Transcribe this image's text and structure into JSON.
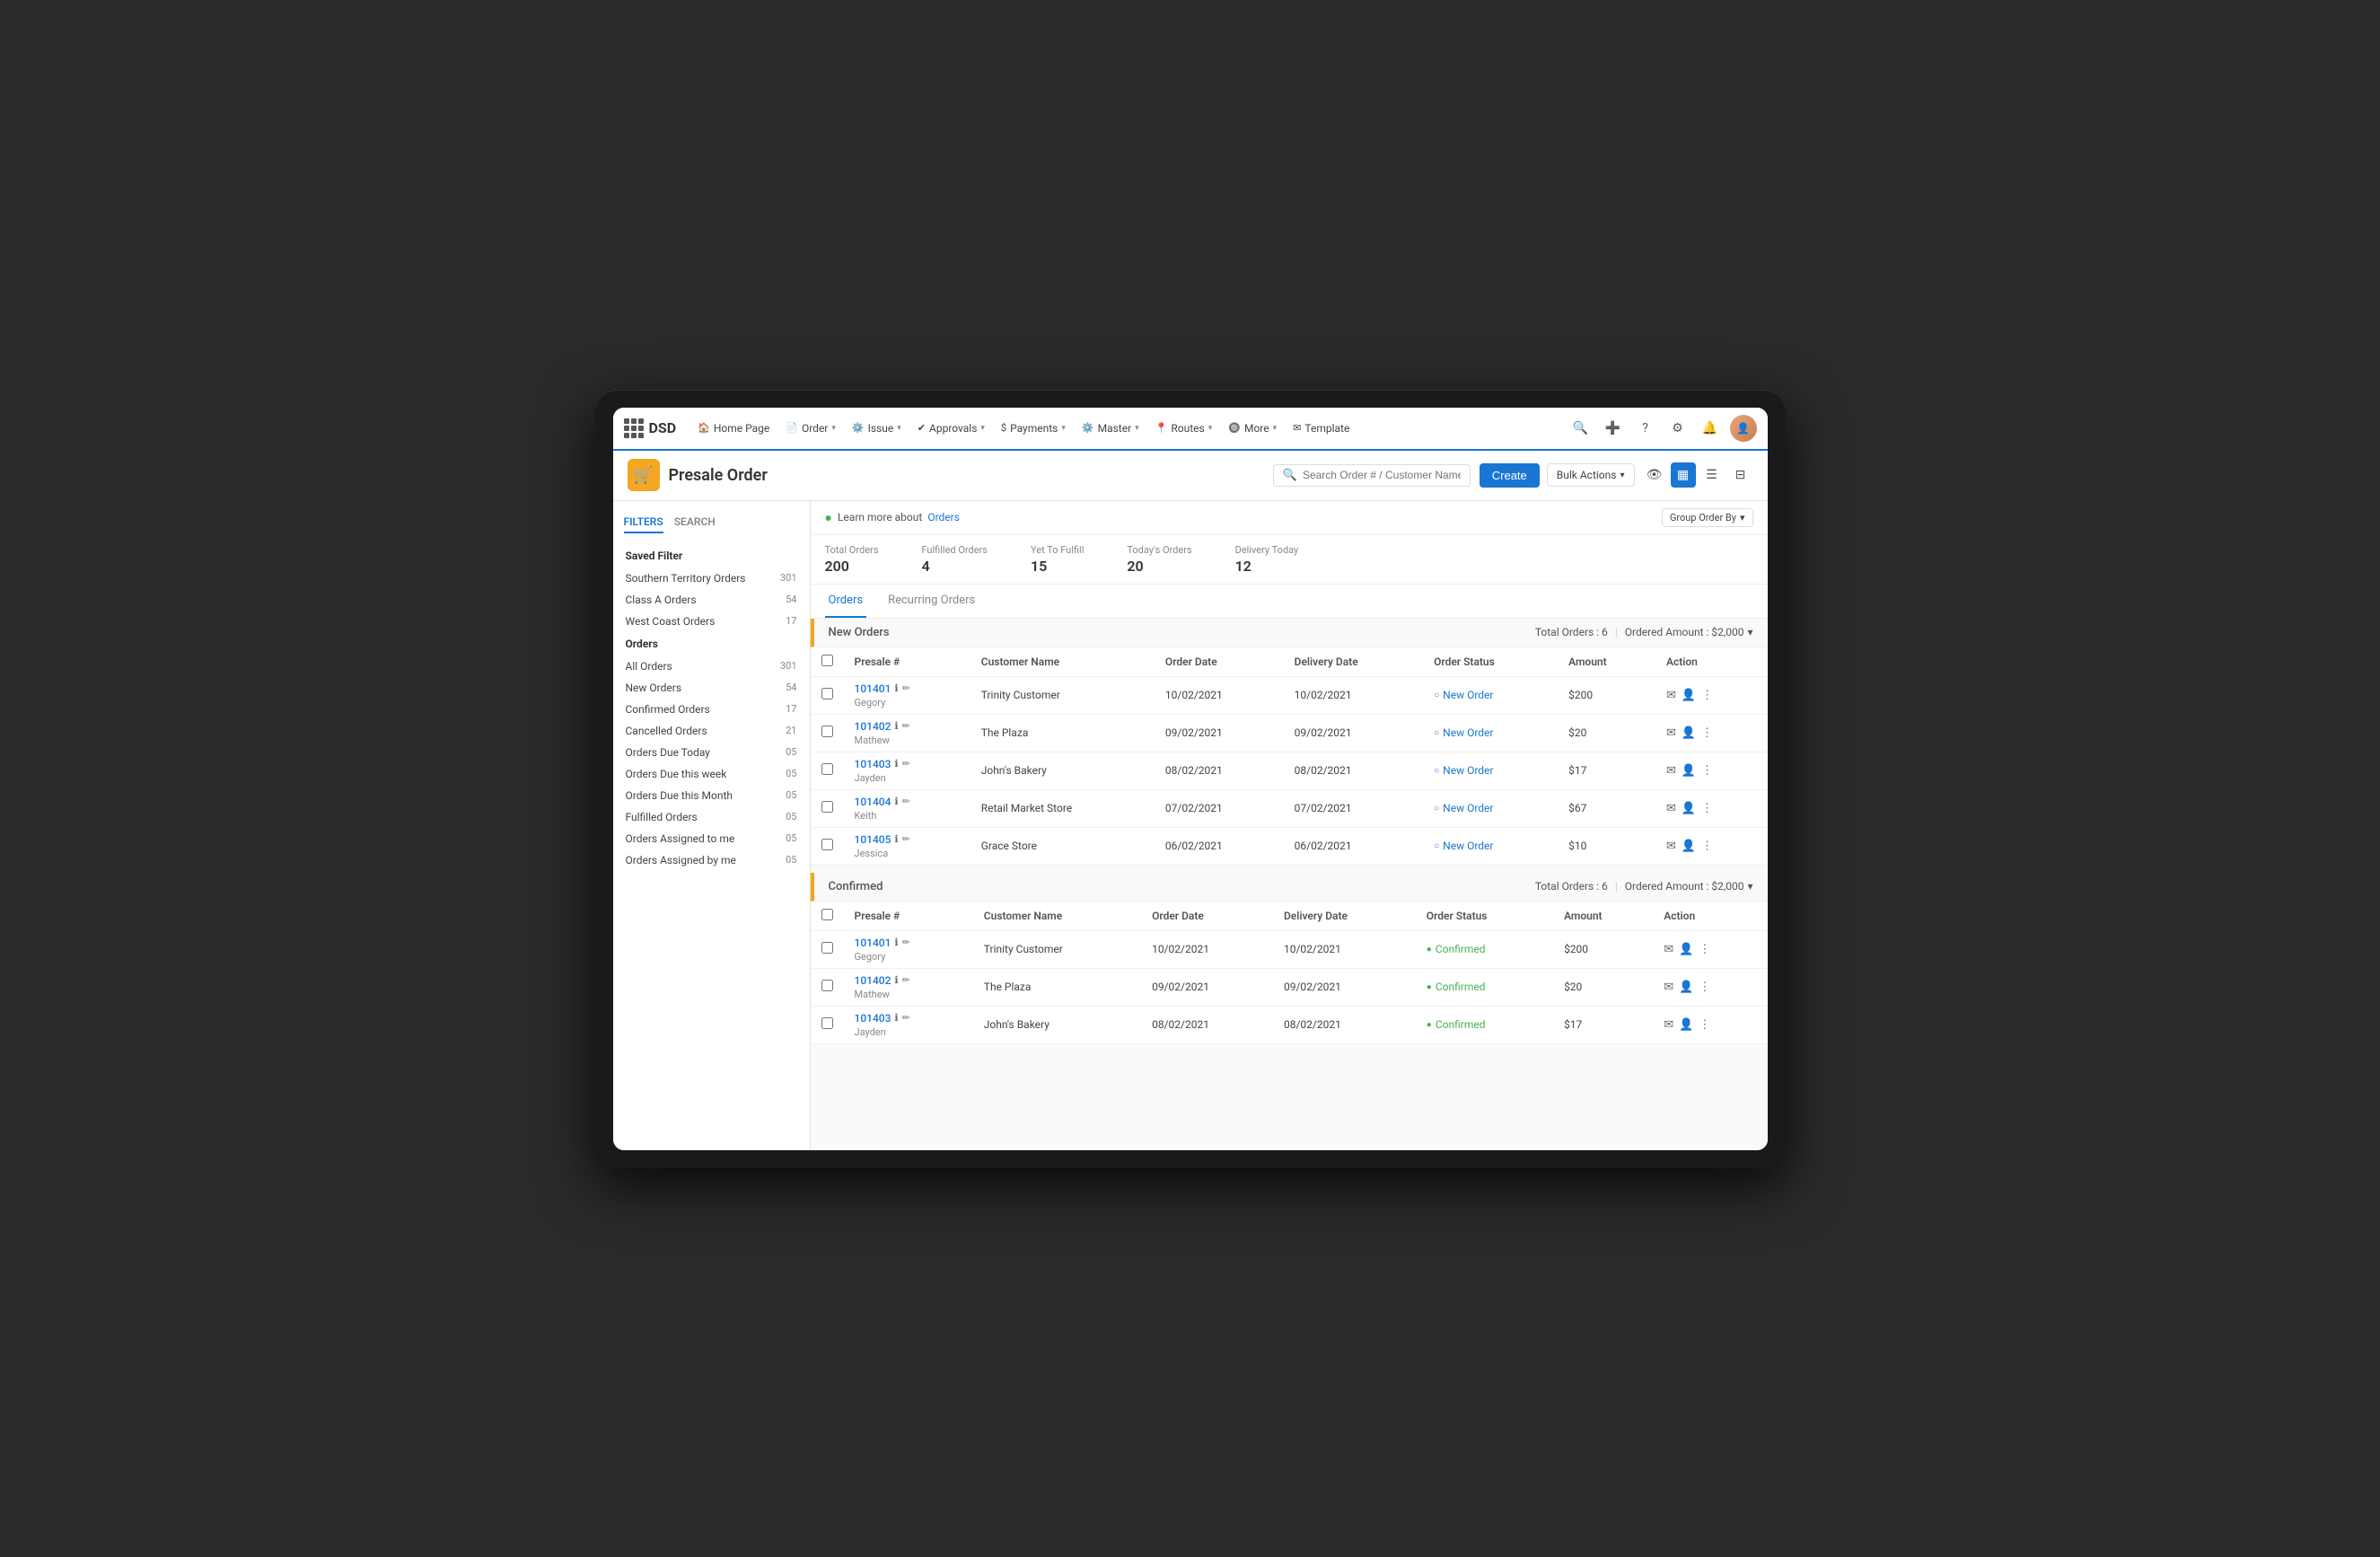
{
  "app": {
    "logo_text": "DSD",
    "nav_items": [
      {
        "label": "Home Page",
        "icon": "🏠",
        "has_dropdown": false
      },
      {
        "label": "Order",
        "icon": "📄",
        "has_dropdown": true
      },
      {
        "label": "Issue",
        "icon": "⚙️",
        "has_dropdown": true
      },
      {
        "label": "Approvals",
        "icon": "✔",
        "has_dropdown": true
      },
      {
        "label": "Payments",
        "icon": "$",
        "has_dropdown": true
      },
      {
        "label": "Master",
        "icon": "⚙️",
        "has_dropdown": true
      },
      {
        "label": "Routes",
        "icon": "📍",
        "has_dropdown": true
      },
      {
        "label": "More",
        "icon": "🔘",
        "has_dropdown": true
      },
      {
        "label": "Template",
        "icon": "✉",
        "has_dropdown": false
      }
    ]
  },
  "page": {
    "title": "Presale Order",
    "icon": "🛒",
    "search_placeholder": "Search Order # / Customer Name",
    "create_label": "Create",
    "bulk_actions_label": "Bulk Actions"
  },
  "info_banner": {
    "text": "Learn more about",
    "link_text": "Orders"
  },
  "group_order_by": "Group Order By",
  "stats": [
    {
      "label": "Total Orders",
      "value": "200"
    },
    {
      "label": "Fulfilled Orders",
      "value": "4"
    },
    {
      "label": "Yet To Fulfill",
      "value": "15"
    },
    {
      "label": "Today's Orders",
      "value": "20"
    },
    {
      "label": "Delivery Today",
      "value": "12"
    }
  ],
  "order_tabs": [
    {
      "label": "Orders",
      "active": true
    },
    {
      "label": "Recurring Orders",
      "active": false
    }
  ],
  "sidebar": {
    "tabs": [
      {
        "label": "FILTERS",
        "active": true
      },
      {
        "label": "SEARCH",
        "active": false
      }
    ],
    "saved_filter_title": "Saved Filter",
    "saved_filters": [
      {
        "label": "Southern Territory Orders",
        "count": "301"
      },
      {
        "label": "Class A Orders",
        "count": "54"
      },
      {
        "label": "West Coast Orders",
        "count": "17"
      }
    ],
    "orders_title": "Orders",
    "order_filters": [
      {
        "label": "All Orders",
        "count": "301"
      },
      {
        "label": "New Orders",
        "count": "54"
      },
      {
        "label": "Confirmed Orders",
        "count": "17"
      },
      {
        "label": "Cancelled Orders",
        "count": "21"
      },
      {
        "label": "Orders Due Today",
        "count": "05"
      },
      {
        "label": "Orders Due this week",
        "count": "05"
      },
      {
        "label": "Orders Due this Month",
        "count": "05"
      },
      {
        "label": "Fulfilled Orders",
        "count": "05"
      },
      {
        "label": "Orders Assigned to me",
        "count": "05"
      },
      {
        "label": "Orders Assigned by me",
        "count": "05"
      }
    ]
  },
  "new_orders_section": {
    "title": "New Orders",
    "total_orders_label": "Total Orders : 6",
    "ordered_amount_label": "Ordered Amount : $2,000",
    "table_headers": [
      "",
      "Presale #",
      "Customer Name",
      "Order Date",
      "Delivery Date",
      "Order Status",
      "Amount",
      "Action"
    ],
    "rows": [
      {
        "id": "101401",
        "person": "Gegory",
        "customer": "Trinity Customer",
        "order_date": "10/02/2021",
        "delivery_date": "10/02/2021",
        "status": "New Order",
        "amount": "$200"
      },
      {
        "id": "101402",
        "person": "Mathew",
        "customer": "The Plaza",
        "order_date": "09/02/2021",
        "delivery_date": "09/02/2021",
        "status": "New Order",
        "amount": "$20"
      },
      {
        "id": "101403",
        "person": "Jayden",
        "customer": "John's Bakery",
        "order_date": "08/02/2021",
        "delivery_date": "08/02/2021",
        "status": "New Order",
        "amount": "$17"
      },
      {
        "id": "101404",
        "person": "Keith",
        "customer": "Retail Market Store",
        "order_date": "07/02/2021",
        "delivery_date": "07/02/2021",
        "status": "New Order",
        "amount": "$67"
      },
      {
        "id": "101405",
        "person": "Jessica",
        "customer": "Grace Store",
        "order_date": "06/02/2021",
        "delivery_date": "06/02/2021",
        "status": "New Order",
        "amount": "$10"
      }
    ]
  },
  "confirmed_section": {
    "title": "Confirmed",
    "total_orders_label": "Total Orders : 6",
    "ordered_amount_label": "Ordered Amount : $2,000",
    "table_headers": [
      "",
      "Presale #",
      "Customer Name",
      "Order Date",
      "Delivery Date",
      "Order Status",
      "Amount",
      "Action"
    ],
    "rows": [
      {
        "id": "101401",
        "person": "Gegory",
        "customer": "Trinity Customer",
        "order_date": "10/02/2021",
        "delivery_date": "10/02/2021",
        "status": "Confirmed",
        "amount": "$200"
      },
      {
        "id": "101402",
        "person": "Mathew",
        "customer": "The Plaza",
        "order_date": "09/02/2021",
        "delivery_date": "09/02/2021",
        "status": "Confirmed",
        "amount": "$20"
      },
      {
        "id": "101403",
        "person": "Jayden",
        "customer": "John's Bakery",
        "order_date": "08/02/2021",
        "delivery_date": "08/02/2021",
        "status": "Confirmed",
        "amount": "$17"
      }
    ]
  }
}
